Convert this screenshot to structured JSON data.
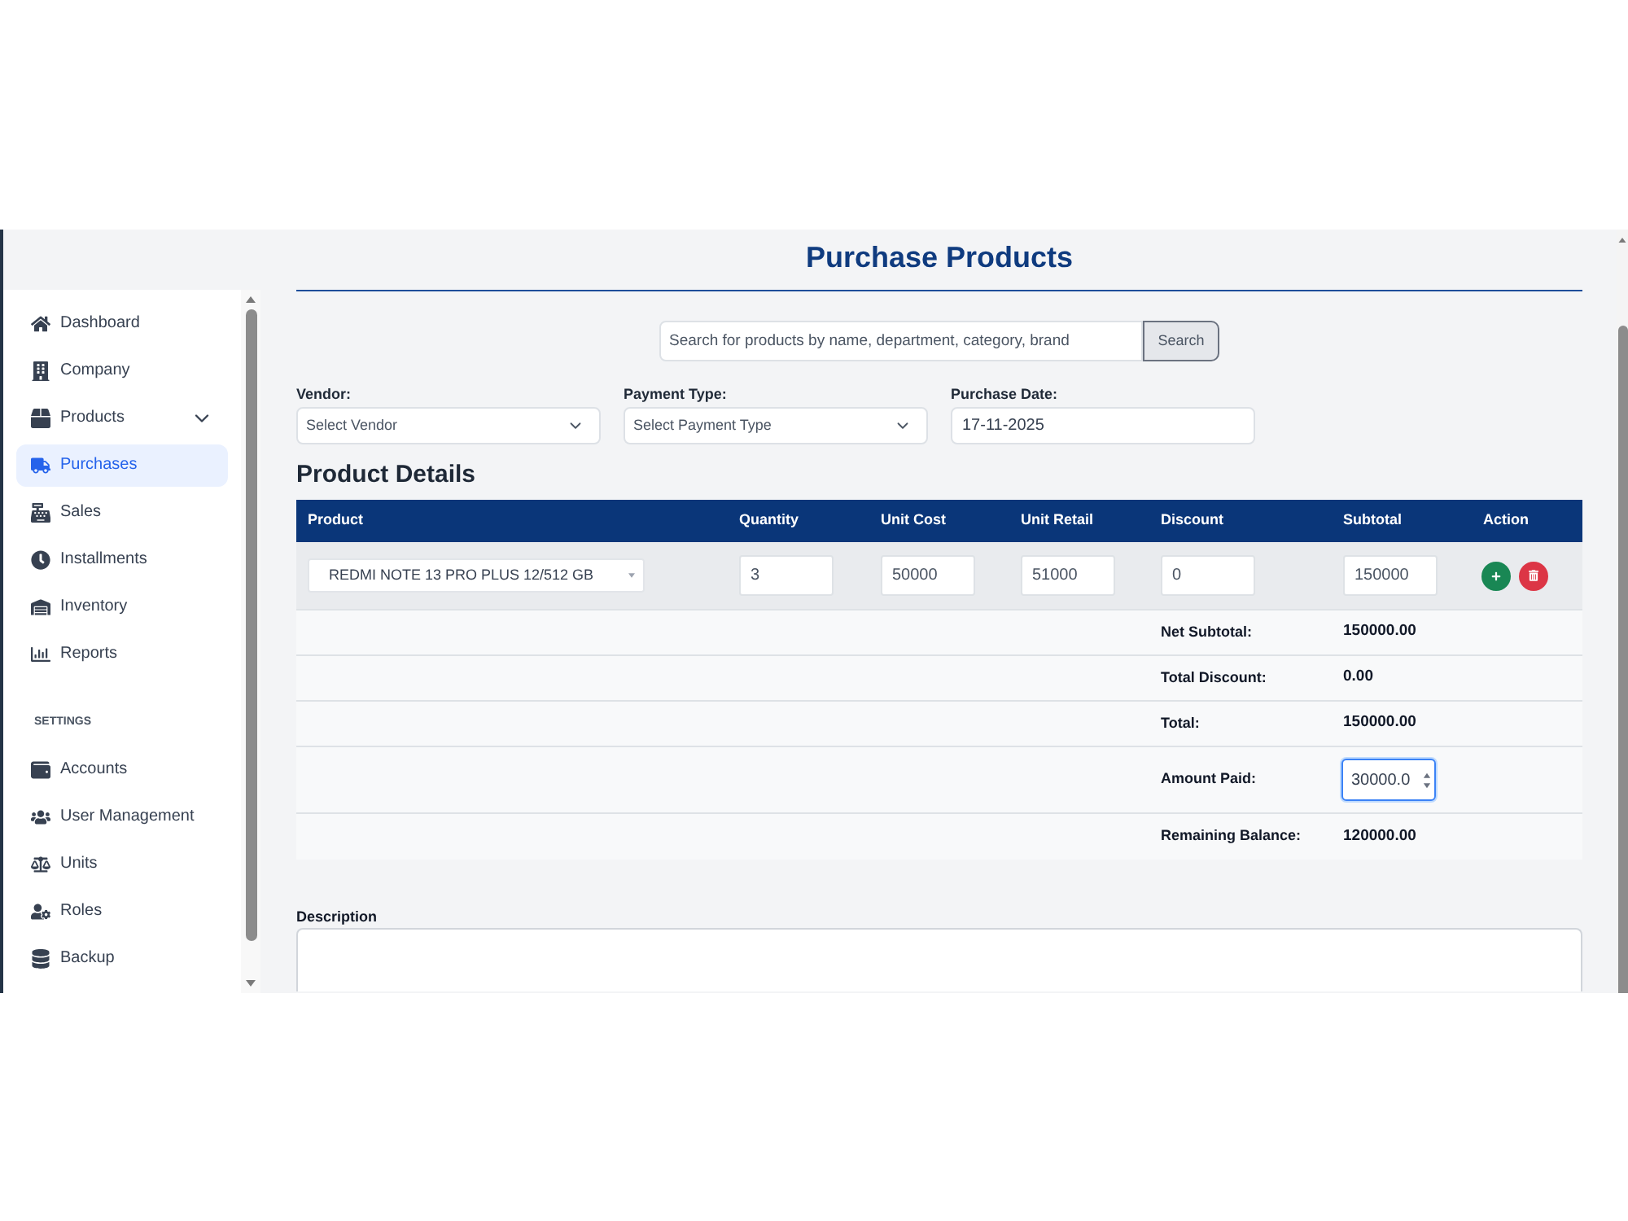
{
  "sidebar": {
    "items": [
      {
        "label": "Dashboard",
        "selected": false
      },
      {
        "label": "Company",
        "selected": false
      },
      {
        "label": "Products",
        "selected": false,
        "expanded": false
      },
      {
        "label": "Purchases",
        "selected": true
      },
      {
        "label": "Sales",
        "selected": false
      },
      {
        "label": "Installments",
        "selected": false
      },
      {
        "label": "Inventory",
        "selected": false
      },
      {
        "label": "Reports",
        "selected": false
      }
    ],
    "section_title": "SETTINGS",
    "settings_items": [
      {
        "label": "Accounts",
        "selected": false
      },
      {
        "label": "User Management",
        "selected": false
      },
      {
        "label": "Units",
        "selected": false
      },
      {
        "label": "Roles",
        "selected": false
      },
      {
        "label": "Backup",
        "selected": false
      }
    ]
  },
  "page": {
    "title": "Purchase Products"
  },
  "search": {
    "placeholder": "Search for products by name, department, category, brand",
    "button": "Search"
  },
  "filters": [
    {
      "label": "Vendor:",
      "kind": "select",
      "value": "Select Vendor"
    },
    {
      "label": "Payment Type:",
      "kind": "select",
      "value": "Select Payment Type"
    },
    {
      "label": "Purchase Date:",
      "kind": "date",
      "value": "17-11-2025"
    }
  ],
  "product_details": {
    "title": "Product Details",
    "columns": [
      "Product",
      "Quantity",
      "Unit Cost",
      "Unit Retail",
      "Discount",
      "Subtotal",
      "Action"
    ],
    "rows": [
      {
        "product": "REDMI NOTE 13 PRO PLUS 12/512 GB",
        "quantity": "3",
        "unit_cost": "50000",
        "unit_retail": "51000",
        "discount": "0",
        "subtotal": "150000"
      }
    ],
    "summary": [
      {
        "kind": "text",
        "label": "Net Subtotal:",
        "value": "150000.00"
      },
      {
        "kind": "text",
        "label": "Total Discount:",
        "value": "0.00"
      },
      {
        "kind": "text",
        "label": "Total:",
        "value": "150000.00"
      },
      {
        "kind": "input",
        "label": "Amount Paid:",
        "value": "30000.0",
        "focused": true
      },
      {
        "kind": "text",
        "label": "Remaining Balance:",
        "value": "120000.00"
      }
    ]
  },
  "description": {
    "label": "Description"
  }
}
